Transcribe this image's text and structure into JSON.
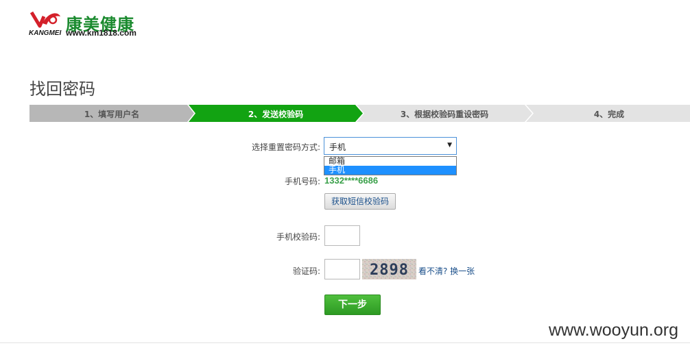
{
  "brand": {
    "name_cn": "康美健康",
    "name_en": "KANGMEI",
    "url": "www.km1818.com",
    "color": "#1a8a2e",
    "logo_icon": "kangmei-logo-icon"
  },
  "page_title": "找回密码",
  "steps": [
    {
      "label": "1、填写用户名",
      "state": "done"
    },
    {
      "label": "2、发送校验码",
      "state": "active"
    },
    {
      "label": "3、根据校验码重设密码",
      "state": "pending"
    },
    {
      "label": "4、完成",
      "state": "pending"
    }
  ],
  "colors": {
    "active_step": "#12a312",
    "done_step": "#b7b7b7",
    "pending_step": "#e3e3e3",
    "phone_text": "#3aa04a",
    "link": "#1a4f8a"
  },
  "form": {
    "method_label": "选择重置密码方式:",
    "method_value": "手机",
    "method_options": [
      "邮箱",
      "手机"
    ],
    "phone_label": "手机号码:",
    "phone_value": "1332****6686",
    "sms_button": "获取短信校验码",
    "sms_code_label": "手机校验码:",
    "captcha_label": "验证码:",
    "captcha_text": "2898",
    "refresh_link": "看不清? 换一张",
    "next_button": "下一步"
  },
  "watermark": "www.wooyun.org"
}
